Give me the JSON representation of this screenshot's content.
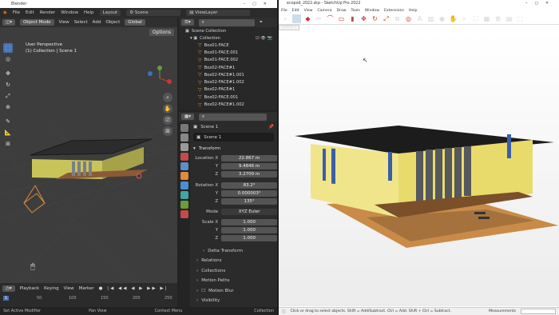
{
  "blender": {
    "title": "Blender",
    "menu": [
      "File",
      "Edit",
      "Render",
      "Window",
      "Help"
    ],
    "workspace_tab": "Layout",
    "scene_name": "Scene",
    "view_layer": "ViewLayer",
    "viewport": {
      "mode": "Object Mode",
      "menus": [
        "View",
        "Select",
        "Add",
        "Object"
      ],
      "transform": "Global",
      "options_label": "Options",
      "view_name": "User Perspective",
      "collection_label": "(1) Collection | Scene 1"
    },
    "outliner": {
      "title": "Scene Collection",
      "collection": "Collection",
      "items": [
        "Box01-FACE",
        "Box01-FACE.001",
        "Box01-FACE.002",
        "Box02-FACE#1",
        "Box02-FACE#1.001",
        "Box02-FACE#1.002",
        "Box02-FACE#1",
        "Box02-FACE.001",
        "Box02-FACE#1.002"
      ]
    },
    "properties": {
      "scene_breadcrumb": "Scene 1",
      "object_name": "Scene 1",
      "transform_label": "Transform",
      "location_label": "Location X",
      "location": [
        "22.867 m",
        "9.4846 m",
        "3.2709 m"
      ],
      "rotation_label": "Rotation X",
      "rotation": [
        "83.2°",
        "0.000003°",
        "135°"
      ],
      "mode_label": "Mode",
      "mode": "XYZ Euler",
      "scale_label": "Scale X",
      "scale": [
        "1.000",
        "1.000",
        "1.000"
      ],
      "axis_y": "Y",
      "axis_z": "Z",
      "sections": [
        "Delta Transform",
        "Relations",
        "Collections",
        "Motion Paths",
        "Motion Blur",
        "Visibility"
      ]
    },
    "timeline": {
      "menus": [
        "Playback",
        "Keying",
        "View",
        "Marker"
      ],
      "current_frame": "1",
      "ticks": [
        "1",
        "50",
        "100",
        "150",
        "200",
        "250"
      ]
    },
    "status": [
      "Set Active Modifier",
      "Pan View",
      "Context Menu",
      "Collection"
    ]
  },
  "sketchup": {
    "title": "ecopod_2022.skp - SketchUp Pro 2022",
    "menu": [
      "File",
      "Edit",
      "View",
      "Camera",
      "Draw",
      "Tools",
      "Window",
      "Extensions",
      "Help"
    ],
    "scene_tab": "Scene 1",
    "status_hint": "Click or drag to select objects. Shift = Add/Subtract. Ctrl = Add. Shift + Ctrl = Subtract.",
    "measurements_label": "Measurements"
  }
}
